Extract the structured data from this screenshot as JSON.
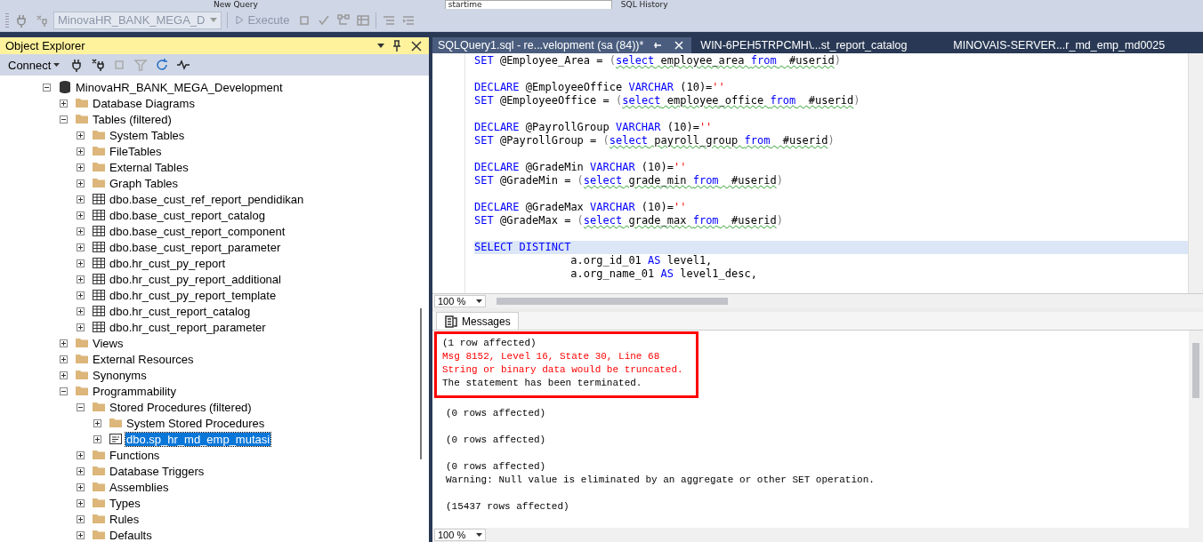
{
  "toolbar_top": {
    "new_query": "New Query",
    "search_value": "startime",
    "sql_history": "SQL History"
  },
  "toolbar": {
    "database": {
      "value": "MinovaHR_BANK_MEGA_D",
      "disabled": true
    },
    "execute": {
      "label": "Execute",
      "disabled": true
    }
  },
  "object_explorer": {
    "title": "Object Explorer",
    "connect": "Connect",
    "tree": [
      {
        "label": "MinovaHR_BANK_MEGA_Development",
        "kind": "database",
        "expanded": true,
        "selected": false,
        "children": [
          {
            "label": "Database Diagrams",
            "kind": "folder",
            "expanded": false,
            "selected": false
          },
          {
            "label": "Tables (filtered)",
            "kind": "folder",
            "expanded": true,
            "selected": false,
            "children": [
              {
                "label": "System Tables",
                "kind": "folder",
                "expanded": false,
                "selected": false
              },
              {
                "label": "FileTables",
                "kind": "folder",
                "expanded": false,
                "selected": false
              },
              {
                "label": "External Tables",
                "kind": "folder",
                "expanded": false,
                "selected": false
              },
              {
                "label": "Graph Tables",
                "kind": "folder",
                "expanded": false,
                "selected": false
              },
              {
                "label": "dbo.base_cust_ref_report_pendidikan",
                "kind": "table",
                "expanded": false,
                "selected": false
              },
              {
                "label": "dbo.base_cust_report_catalog",
                "kind": "table",
                "expanded": false,
                "selected": false
              },
              {
                "label": "dbo.base_cust_report_component",
                "kind": "table",
                "expanded": false,
                "selected": false
              },
              {
                "label": "dbo.base_cust_report_parameter",
                "kind": "table",
                "expanded": false,
                "selected": false
              },
              {
                "label": "dbo.hr_cust_py_report",
                "kind": "table",
                "expanded": false,
                "selected": false
              },
              {
                "label": "dbo.hr_cust_py_report_additional",
                "kind": "table",
                "expanded": false,
                "selected": false
              },
              {
                "label": "dbo.hr_cust_py_report_template",
                "kind": "table",
                "expanded": false,
                "selected": false
              },
              {
                "label": "dbo.hr_cust_report_catalog",
                "kind": "table",
                "expanded": false,
                "selected": false
              },
              {
                "label": "dbo.hr_cust_report_parameter",
                "kind": "table",
                "expanded": false,
                "selected": false
              }
            ]
          },
          {
            "label": "Views",
            "kind": "folder",
            "expanded": false,
            "selected": false
          },
          {
            "label": "External Resources",
            "kind": "folder",
            "expanded": false,
            "selected": false
          },
          {
            "label": "Synonyms",
            "kind": "folder",
            "expanded": false,
            "selected": false
          },
          {
            "label": "Programmability",
            "kind": "folder",
            "expanded": true,
            "selected": false,
            "children": [
              {
                "label": "Stored Procedures (filtered)",
                "kind": "folder",
                "expanded": true,
                "selected": false,
                "children": [
                  {
                    "label": "System Stored Procedures",
                    "kind": "folder",
                    "expanded": false,
                    "selected": false
                  },
                  {
                    "label": "dbo.sp_hr_md_emp_mutasi",
                    "kind": "procedure",
                    "expanded": false,
                    "selected": true
                  }
                ]
              },
              {
                "label": "Functions",
                "kind": "folder",
                "expanded": false,
                "selected": false
              },
              {
                "label": "Database Triggers",
                "kind": "folder",
                "expanded": false,
                "selected": false
              },
              {
                "label": "Assemblies",
                "kind": "folder",
                "expanded": false,
                "selected": false
              },
              {
                "label": "Types",
                "kind": "folder",
                "expanded": false,
                "selected": false
              },
              {
                "label": "Rules",
                "kind": "folder",
                "expanded": false,
                "selected": false
              },
              {
                "label": "Defaults",
                "kind": "folder",
                "expanded": false,
                "selected": false
              }
            ]
          }
        ]
      }
    ]
  },
  "tabs": [
    {
      "label": "SQLQuery1.sql - re...velopment (sa (84))*",
      "selected": true
    },
    {
      "label": "WIN-6PEH5TRPCMH\\...st_report_catalog",
      "selected": false
    },
    {
      "label": "MINOVAIS-SERVER...r_md_emp_md0025",
      "selected": false
    }
  ],
  "editor": {
    "zoom": "100 %",
    "lines": [
      {
        "segments": [
          {
            "t": "SET",
            "kind": "kw"
          },
          {
            "t": " @Employee_Area = ",
            "kind": "txt"
          },
          {
            "t": "(",
            "kind": "gray"
          },
          {
            "t": "select",
            "kind": "kw",
            "squiggle": true
          },
          {
            "t": " employee_area ",
            "kind": "txt",
            "squiggle": true
          },
          {
            "t": "from",
            "kind": "kw",
            "squiggle": true
          },
          {
            "t": "  #userid",
            "kind": "txt",
            "squiggle": true
          },
          {
            "t": ")",
            "kind": "gray"
          }
        ],
        "blank_after": true
      },
      {
        "segments": [
          {
            "t": "DECLARE",
            "kind": "kw"
          },
          {
            "t": " @EmployeeOffice ",
            "kind": "txt"
          },
          {
            "t": "VARCHAR",
            "kind": "kw"
          },
          {
            "t": " (10)=",
            "kind": "txt"
          },
          {
            "t": "''",
            "kind": "str"
          }
        ],
        "blank_after": false
      },
      {
        "segments": [
          {
            "t": "SET",
            "kind": "kw"
          },
          {
            "t": " @EmployeeOffice = ",
            "kind": "txt"
          },
          {
            "t": "(",
            "kind": "gray"
          },
          {
            "t": "select",
            "kind": "kw",
            "squiggle": true
          },
          {
            "t": " employee_office ",
            "kind": "txt",
            "squiggle": true
          },
          {
            "t": "from",
            "kind": "kw",
            "squiggle": true
          },
          {
            "t": "  #userid",
            "kind": "txt",
            "squiggle": true
          },
          {
            "t": ")",
            "kind": "gray"
          }
        ],
        "blank_after": true
      },
      {
        "segments": [
          {
            "t": "DECLARE",
            "kind": "kw"
          },
          {
            "t": " @PayrollGroup ",
            "kind": "txt"
          },
          {
            "t": "VARCHAR",
            "kind": "kw"
          },
          {
            "t": " (10)=",
            "kind": "txt"
          },
          {
            "t": "''",
            "kind": "str"
          }
        ],
        "blank_after": false
      },
      {
        "segments": [
          {
            "t": "SET",
            "kind": "kw"
          },
          {
            "t": " @PayrollGroup = ",
            "kind": "txt"
          },
          {
            "t": "(",
            "kind": "gray"
          },
          {
            "t": "select",
            "kind": "kw",
            "squiggle": true
          },
          {
            "t": " payroll_group ",
            "kind": "txt",
            "squiggle": true
          },
          {
            "t": "from",
            "kind": "kw",
            "squiggle": true
          },
          {
            "t": "  #userid",
            "kind": "txt",
            "squiggle": true
          },
          {
            "t": ")",
            "kind": "gray"
          }
        ],
        "blank_after": true
      },
      {
        "segments": [
          {
            "t": "DECLARE",
            "kind": "kw"
          },
          {
            "t": " @GradeMin ",
            "kind": "txt"
          },
          {
            "t": "VARCHAR",
            "kind": "kw"
          },
          {
            "t": " (10)=",
            "kind": "txt"
          },
          {
            "t": "''",
            "kind": "str"
          }
        ],
        "blank_after": false
      },
      {
        "segments": [
          {
            "t": "SET",
            "kind": "kw"
          },
          {
            "t": " @GradeMin = ",
            "kind": "txt"
          },
          {
            "t": "(",
            "kind": "gray"
          },
          {
            "t": "select",
            "kind": "kw",
            "squiggle": true
          },
          {
            "t": " grade_min ",
            "kind": "txt",
            "squiggle": true
          },
          {
            "t": "from",
            "kind": "kw",
            "squiggle": true
          },
          {
            "t": "  #userid",
            "kind": "txt",
            "squiggle": true
          },
          {
            "t": ")",
            "kind": "gray"
          }
        ],
        "blank_after": true
      },
      {
        "segments": [
          {
            "t": "DECLARE",
            "kind": "kw"
          },
          {
            "t": " @GradeMax ",
            "kind": "txt"
          },
          {
            "t": "VARCHAR",
            "kind": "kw"
          },
          {
            "t": " (10)=",
            "kind": "txt"
          },
          {
            "t": "''",
            "kind": "str"
          }
        ],
        "blank_after": false
      },
      {
        "segments": [
          {
            "t": "SET",
            "kind": "kw"
          },
          {
            "t": " @GradeMax = ",
            "kind": "txt"
          },
          {
            "t": "(",
            "kind": "gray"
          },
          {
            "t": "select",
            "kind": "kw",
            "squiggle": true
          },
          {
            "t": " grade_max ",
            "kind": "txt",
            "squiggle": true
          },
          {
            "t": "from",
            "kind": "kw",
            "squiggle": true
          },
          {
            "t": "  #userid",
            "kind": "txt",
            "squiggle": true
          },
          {
            "t": ")",
            "kind": "gray"
          }
        ],
        "blank_after": true
      },
      {
        "segments": [
          {
            "t": "SELECT DISTINCT",
            "kind": "kw"
          }
        ],
        "blank_after": false,
        "collapsible": true
      },
      {
        "segments": [
          {
            "t": "               a.org_id_01 ",
            "kind": "txt"
          },
          {
            "t": "AS",
            "kind": "kw"
          },
          {
            "t": " level1,",
            "kind": "txt"
          }
        ],
        "blank_after": false
      },
      {
        "segments": [
          {
            "t": "               a.org_name_01 ",
            "kind": "txt"
          },
          {
            "t": "AS",
            "kind": "kw"
          },
          {
            "t": " level1_desc,",
            "kind": "txt"
          }
        ],
        "blank_after": false
      }
    ]
  },
  "results": {
    "tab": "Messages",
    "zoom": "100 %",
    "blocks": [
      {
        "highlighted": true,
        "lines": [
          {
            "text": "(1 row affected)",
            "kind": "info"
          },
          {
            "text": "Msg 8152, Level 16, State 30, Line 68",
            "kind": "error"
          },
          {
            "text": "String or binary data would be truncated.",
            "kind": "error"
          },
          {
            "text": "The statement has been terminated.",
            "kind": "info"
          }
        ]
      },
      {
        "highlighted": false,
        "lines": [
          {
            "text": "(0 rows affected)",
            "kind": "info"
          }
        ]
      },
      {
        "highlighted": false,
        "lines": [
          {
            "text": "(0 rows affected)",
            "kind": "info"
          }
        ]
      },
      {
        "highlighted": false,
        "lines": [
          {
            "text": "(0 rows affected)",
            "kind": "info"
          },
          {
            "text": "Warning: Null value is eliminated by an aggregate or other SET operation.",
            "kind": "info"
          }
        ]
      },
      {
        "highlighted": false,
        "lines": [
          {
            "text": "(15437 rows affected)",
            "kind": "info"
          }
        ]
      }
    ]
  }
}
